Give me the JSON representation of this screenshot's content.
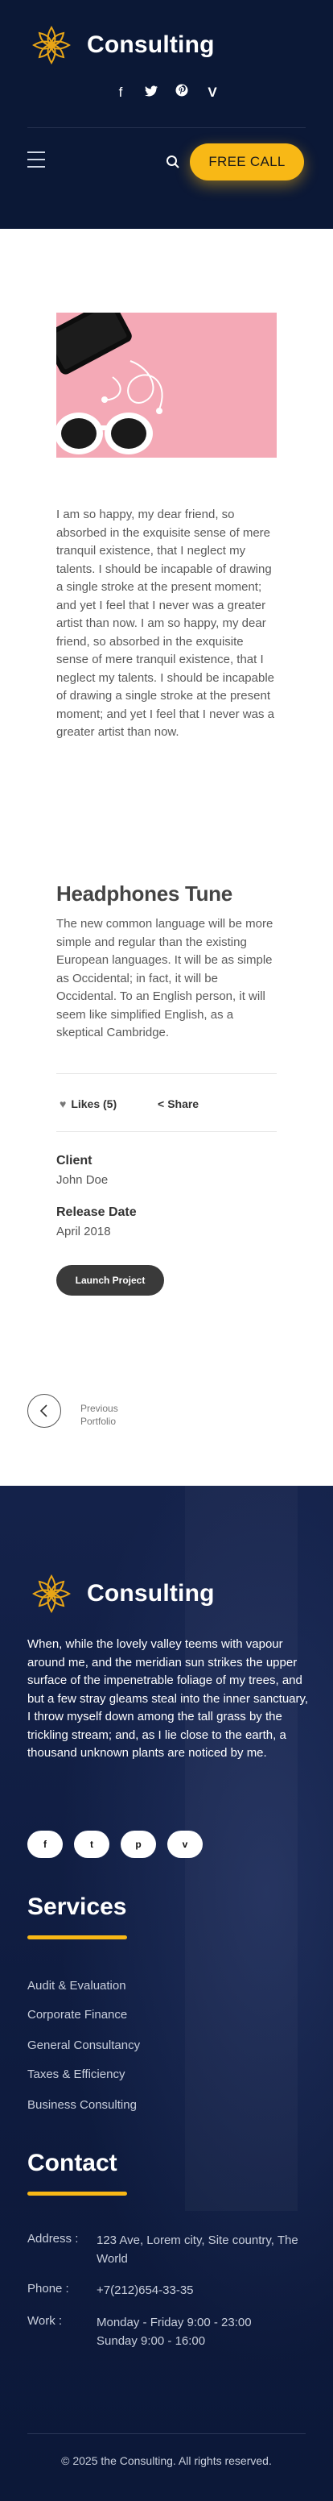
{
  "brand": {
    "name": "Consulting",
    "accent_color": "#f8b816",
    "dark_color": "#0b1836"
  },
  "header": {
    "social_icons": [
      "facebook-icon",
      "twitter-icon",
      "pinterest-icon",
      "vimeo-icon"
    ],
    "social_glyphs": [
      "f",
      "🐦",
      "P",
      "V"
    ],
    "call_button": "FREE CALL"
  },
  "project": {
    "intro": "I am so happy, my dear friend, so absorbed in the exquisite sense of mere tranquil existence, that I neglect my talents. I should be incapable of drawing a single stroke at the present moment; and yet I feel that I never was a greater artist than now. I am so happy, my dear friend, so absorbed in the exquisite sense of mere tranquil existence, that I neglect my talents. I should be incapable of drawing a single stroke at the present moment; and yet I feel that I never was a greater artist than now.",
    "title": "Headphones Tune",
    "description": "The new common language will be more simple and regular than the existing European languages. It will be as simple as Occidental; in fact, it will be Occidental. To an English person, it will seem like simplified English, as a skeptical Cambridge.",
    "likes": "Likes (5)",
    "share": "Share",
    "client_label": "Client",
    "client_value": "John Doe",
    "release_label": "Release Date",
    "release_value": "April 2018",
    "launch_button": "Launch Project",
    "prev_line1": "Previous",
    "prev_line2": "Portfolio"
  },
  "footer": {
    "about": "When, while the lovely valley teems with vapour around me, and the meridian sun strikes the upper surface of the impenetrable foliage of my trees, and but a few stray gleams steal into the inner sanctuary, I throw myself down among the tall grass by the trickling stream; and, as I lie close to the earth, a thousand unknown plants are noticed by me.",
    "social_glyphs": [
      "f",
      "t",
      "p",
      "v"
    ],
    "services_heading": "Services",
    "services": [
      "Audit & Evaluation",
      "Corporate Finance",
      "General Consultancy",
      "Taxes & Efficiency",
      "Business Consulting"
    ],
    "contact_heading": "Contact",
    "contact": [
      {
        "label": "Address :",
        "value": "123 Ave, Lorem city, Site country, The World"
      },
      {
        "label": "Phone :",
        "value": "+7(212)654-33-35"
      },
      {
        "label": "Work :",
        "value": "Monday - Friday 9:00 - 23:00\nSunday 9:00 - 16:00"
      }
    ],
    "copyright": "© 2025 the Consulting. All rights reserved."
  }
}
